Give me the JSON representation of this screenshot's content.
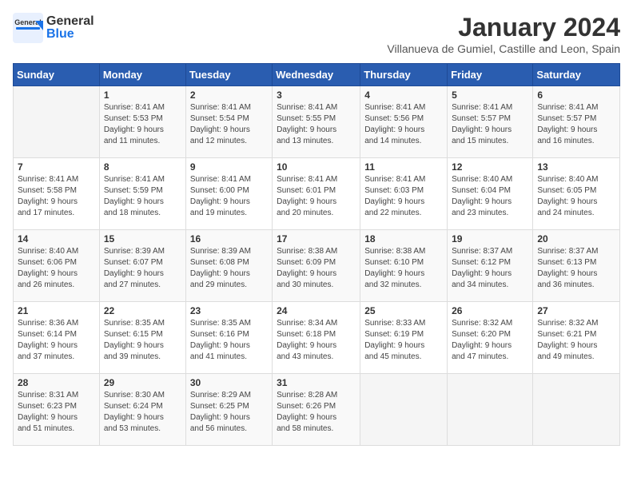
{
  "app": {
    "name_general": "General",
    "name_blue": "Blue"
  },
  "header": {
    "month": "January 2024",
    "location": "Villanueva de Gumiel, Castille and Leon, Spain"
  },
  "calendar": {
    "days_of_week": [
      "Sunday",
      "Monday",
      "Tuesday",
      "Wednesday",
      "Thursday",
      "Friday",
      "Saturday"
    ],
    "weeks": [
      [
        {
          "day": "",
          "info": ""
        },
        {
          "day": "1",
          "info": "Sunrise: 8:41 AM\nSunset: 5:53 PM\nDaylight: 9 hours\nand 11 minutes."
        },
        {
          "day": "2",
          "info": "Sunrise: 8:41 AM\nSunset: 5:54 PM\nDaylight: 9 hours\nand 12 minutes."
        },
        {
          "day": "3",
          "info": "Sunrise: 8:41 AM\nSunset: 5:55 PM\nDaylight: 9 hours\nand 13 minutes."
        },
        {
          "day": "4",
          "info": "Sunrise: 8:41 AM\nSunset: 5:56 PM\nDaylight: 9 hours\nand 14 minutes."
        },
        {
          "day": "5",
          "info": "Sunrise: 8:41 AM\nSunset: 5:57 PM\nDaylight: 9 hours\nand 15 minutes."
        },
        {
          "day": "6",
          "info": "Sunrise: 8:41 AM\nSunset: 5:57 PM\nDaylight: 9 hours\nand 16 minutes."
        }
      ],
      [
        {
          "day": "7",
          "info": "Sunrise: 8:41 AM\nSunset: 5:58 PM\nDaylight: 9 hours\nand 17 minutes."
        },
        {
          "day": "8",
          "info": "Sunrise: 8:41 AM\nSunset: 5:59 PM\nDaylight: 9 hours\nand 18 minutes."
        },
        {
          "day": "9",
          "info": "Sunrise: 8:41 AM\nSunset: 6:00 PM\nDaylight: 9 hours\nand 19 minutes."
        },
        {
          "day": "10",
          "info": "Sunrise: 8:41 AM\nSunset: 6:01 PM\nDaylight: 9 hours\nand 20 minutes."
        },
        {
          "day": "11",
          "info": "Sunrise: 8:41 AM\nSunset: 6:03 PM\nDaylight: 9 hours\nand 22 minutes."
        },
        {
          "day": "12",
          "info": "Sunrise: 8:40 AM\nSunset: 6:04 PM\nDaylight: 9 hours\nand 23 minutes."
        },
        {
          "day": "13",
          "info": "Sunrise: 8:40 AM\nSunset: 6:05 PM\nDaylight: 9 hours\nand 24 minutes."
        }
      ],
      [
        {
          "day": "14",
          "info": "Sunrise: 8:40 AM\nSunset: 6:06 PM\nDaylight: 9 hours\nand 26 minutes."
        },
        {
          "day": "15",
          "info": "Sunrise: 8:39 AM\nSunset: 6:07 PM\nDaylight: 9 hours\nand 27 minutes."
        },
        {
          "day": "16",
          "info": "Sunrise: 8:39 AM\nSunset: 6:08 PM\nDaylight: 9 hours\nand 29 minutes."
        },
        {
          "day": "17",
          "info": "Sunrise: 8:38 AM\nSunset: 6:09 PM\nDaylight: 9 hours\nand 30 minutes."
        },
        {
          "day": "18",
          "info": "Sunrise: 8:38 AM\nSunset: 6:10 PM\nDaylight: 9 hours\nand 32 minutes."
        },
        {
          "day": "19",
          "info": "Sunrise: 8:37 AM\nSunset: 6:12 PM\nDaylight: 9 hours\nand 34 minutes."
        },
        {
          "day": "20",
          "info": "Sunrise: 8:37 AM\nSunset: 6:13 PM\nDaylight: 9 hours\nand 36 minutes."
        }
      ],
      [
        {
          "day": "21",
          "info": "Sunrise: 8:36 AM\nSunset: 6:14 PM\nDaylight: 9 hours\nand 37 minutes."
        },
        {
          "day": "22",
          "info": "Sunrise: 8:35 AM\nSunset: 6:15 PM\nDaylight: 9 hours\nand 39 minutes."
        },
        {
          "day": "23",
          "info": "Sunrise: 8:35 AM\nSunset: 6:16 PM\nDaylight: 9 hours\nand 41 minutes."
        },
        {
          "day": "24",
          "info": "Sunrise: 8:34 AM\nSunset: 6:18 PM\nDaylight: 9 hours\nand 43 minutes."
        },
        {
          "day": "25",
          "info": "Sunrise: 8:33 AM\nSunset: 6:19 PM\nDaylight: 9 hours\nand 45 minutes."
        },
        {
          "day": "26",
          "info": "Sunrise: 8:32 AM\nSunset: 6:20 PM\nDaylight: 9 hours\nand 47 minutes."
        },
        {
          "day": "27",
          "info": "Sunrise: 8:32 AM\nSunset: 6:21 PM\nDaylight: 9 hours\nand 49 minutes."
        }
      ],
      [
        {
          "day": "28",
          "info": "Sunrise: 8:31 AM\nSunset: 6:23 PM\nDaylight: 9 hours\nand 51 minutes."
        },
        {
          "day": "29",
          "info": "Sunrise: 8:30 AM\nSunset: 6:24 PM\nDaylight: 9 hours\nand 53 minutes."
        },
        {
          "day": "30",
          "info": "Sunrise: 8:29 AM\nSunset: 6:25 PM\nDaylight: 9 hours\nand 56 minutes."
        },
        {
          "day": "31",
          "info": "Sunrise: 8:28 AM\nSunset: 6:26 PM\nDaylight: 9 hours\nand 58 minutes."
        },
        {
          "day": "",
          "info": ""
        },
        {
          "day": "",
          "info": ""
        },
        {
          "day": "",
          "info": ""
        }
      ]
    ]
  }
}
